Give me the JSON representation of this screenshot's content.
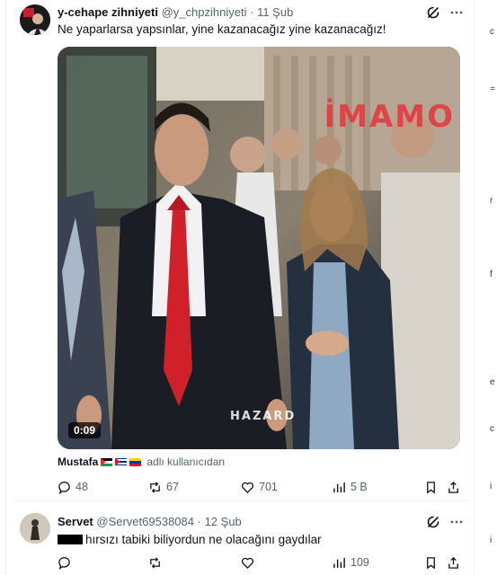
{
  "tweets": [
    {
      "author_name": "y-cehape zihniyeti",
      "handle": "@y_chpzihniyeti",
      "separator": "·",
      "time": "11 Şub",
      "text": "Ne yaparlarsa yapsınlar, yine kazanacağız yine kazanacağız!",
      "media": {
        "duration": "0:09",
        "watermark": "İMAMO",
        "caption_overlay": "HAZARD"
      },
      "attribution": {
        "name": "Mustafa",
        "flags": [
          "flag-palestine",
          "flag-cuba",
          "flag-venezuela"
        ],
        "suffix": "adlı kullanıcıdan"
      },
      "actions": {
        "replies": "48",
        "retweets": "67",
        "likes": "701",
        "views": "5 B"
      }
    },
    {
      "author_name": "Servet",
      "handle": "@Servet69538084",
      "separator": "·",
      "time": "12 Şub",
      "text": "hırsızı tabiki biliyordun ne olacağını gaydılar",
      "actions": {
        "replies": "",
        "retweets": "",
        "likes": "",
        "views": "109"
      }
    }
  ],
  "icons": {
    "grok": "grok-icon",
    "more": "more-icon",
    "reply": "reply-icon",
    "retweet": "retweet-icon",
    "like": "like-icon",
    "views": "views-icon",
    "bookmark": "bookmark-icon",
    "share": "share-icon"
  },
  "colors": {
    "text_primary": "#0f1419",
    "text_secondary": "#536471",
    "divider": "#eff3f4",
    "watermark_red": "#e6323c",
    "tie_red": "#d0202a"
  }
}
